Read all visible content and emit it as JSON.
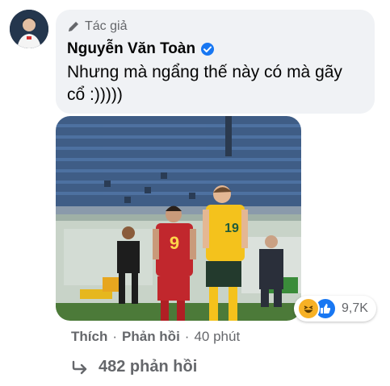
{
  "comment": {
    "author_badge": "Tác giả",
    "author_name": "Nguyễn Văn Toàn",
    "text": "Nhưng mà ngẩng thế này có mà gãy cổ :)))))",
    "reactions": {
      "icons": [
        "haha-icon",
        "like-icon"
      ],
      "count": "9,7K"
    },
    "actions": {
      "like": "Thích",
      "separator": "·",
      "reply": "Phản hồi",
      "time": "40 phút"
    },
    "replies_label": "482 phản hồi",
    "photo": {
      "player_left_number": "9",
      "player_right_number": "19"
    }
  },
  "colors": {
    "bubble_bg": "#f0f2f5",
    "secondary_text": "#65676b",
    "primary_text": "#050505",
    "verified_blue": "#1877f2",
    "haha_yellow": "#f7b125",
    "like_blue": "#1877f2"
  }
}
